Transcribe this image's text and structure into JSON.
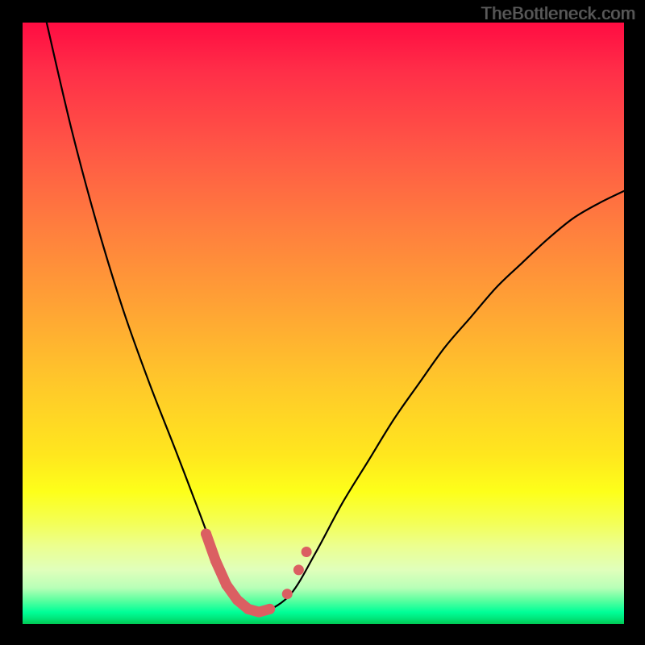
{
  "watermark": "TheBottleneck.com",
  "colors": {
    "page_bg": "#000000",
    "curve": "#000000",
    "markers": "#db5f62",
    "gradient_top": "#ff0c42",
    "gradient_mid": "#ffe71e",
    "gradient_bottom": "#00c954"
  },
  "chart_data": {
    "type": "line",
    "title": "",
    "xlabel": "",
    "ylabel": "",
    "xlim": [
      0,
      100
    ],
    "ylim": [
      0,
      100
    ],
    "grid": false,
    "legend": false,
    "series": [
      {
        "name": "bottleneck-curve",
        "x": [
          4.0,
          8.2,
          12.5,
          16.8,
          21.1,
          25.4,
          29.6,
          31.8,
          33.9,
          36.0,
          38.2,
          40.3,
          44.6,
          48.8,
          53.1,
          57.4,
          61.7,
          65.9,
          70.2,
          74.5,
          78.8,
          83.0,
          87.3,
          91.6,
          95.9,
          100.0
        ],
        "y": [
          100.0,
          82.0,
          66.0,
          52.0,
          40.0,
          29.0,
          18.0,
          12.0,
          7.0,
          3.5,
          2.0,
          2.0,
          5.0,
          12.0,
          20.0,
          27.0,
          34.0,
          40.0,
          46.0,
          51.0,
          56.0,
          60.0,
          64.0,
          67.5,
          70.0,
          72.0
        ]
      }
    ],
    "markers": {
      "name": "highlighted-points",
      "x": [
        30.5,
        32.1,
        33.9,
        35.7,
        37.5,
        39.3,
        41.1,
        44.0,
        45.9,
        47.2
      ],
      "y": [
        15.0,
        10.5,
        6.5,
        4.0,
        2.5,
        2.0,
        2.5,
        5.0,
        9.0,
        12.0
      ]
    }
  }
}
